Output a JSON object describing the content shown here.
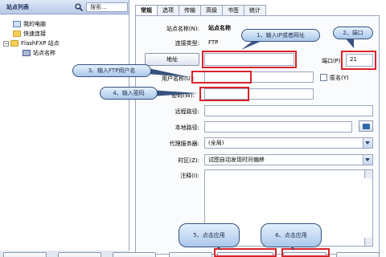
{
  "left": {
    "title": "站点列表",
    "search_label": "搜索...",
    "tree": [
      {
        "label": "我的电脑",
        "icon": "computer-icon"
      },
      {
        "label": "快速连接",
        "icon": "folder-icon"
      },
      {
        "label": "FlashFXP 站点",
        "icon": "folder-icon"
      },
      {
        "label": "站点名称",
        "icon": "server-icon"
      }
    ]
  },
  "tabs": [
    "常规",
    "选项",
    "传输",
    "高级",
    "书签",
    "统计"
  ],
  "form": {
    "site_name_label": "站点名称(N):",
    "site_name_value": "站点名称",
    "conn_type_label": "连接类型:",
    "conn_type_value": "FTP",
    "address_button": "地址",
    "address_value": "",
    "port_label": "端口(P):",
    "port_value": "21",
    "username_label": "用户名称(U):",
    "username_value": "",
    "anonymous_label": "匿名(Y)",
    "password_label": "密码(W):",
    "password_value": "",
    "remote_path_label": "远程路径:",
    "remote_path_value": "",
    "local_path_label": "本地路径:",
    "local_path_value": "",
    "proxy_label": "代理服务器:",
    "proxy_value": "(全局)",
    "timezone_label": "时区(Z):",
    "timezone_value": "试图自动发现时间偏移",
    "notes_label": "注释(I):"
  },
  "annotations": {
    "step1": "1、输入IP或者网址",
    "step2": "2、端口",
    "step3": "3、输入FTP用户名",
    "step4": "4、输入密码",
    "step5": "5、点击应用",
    "step6": "6、点击应用"
  },
  "colors": {
    "annotation": "#d8242a",
    "callout_fill": "#aac8ea"
  }
}
